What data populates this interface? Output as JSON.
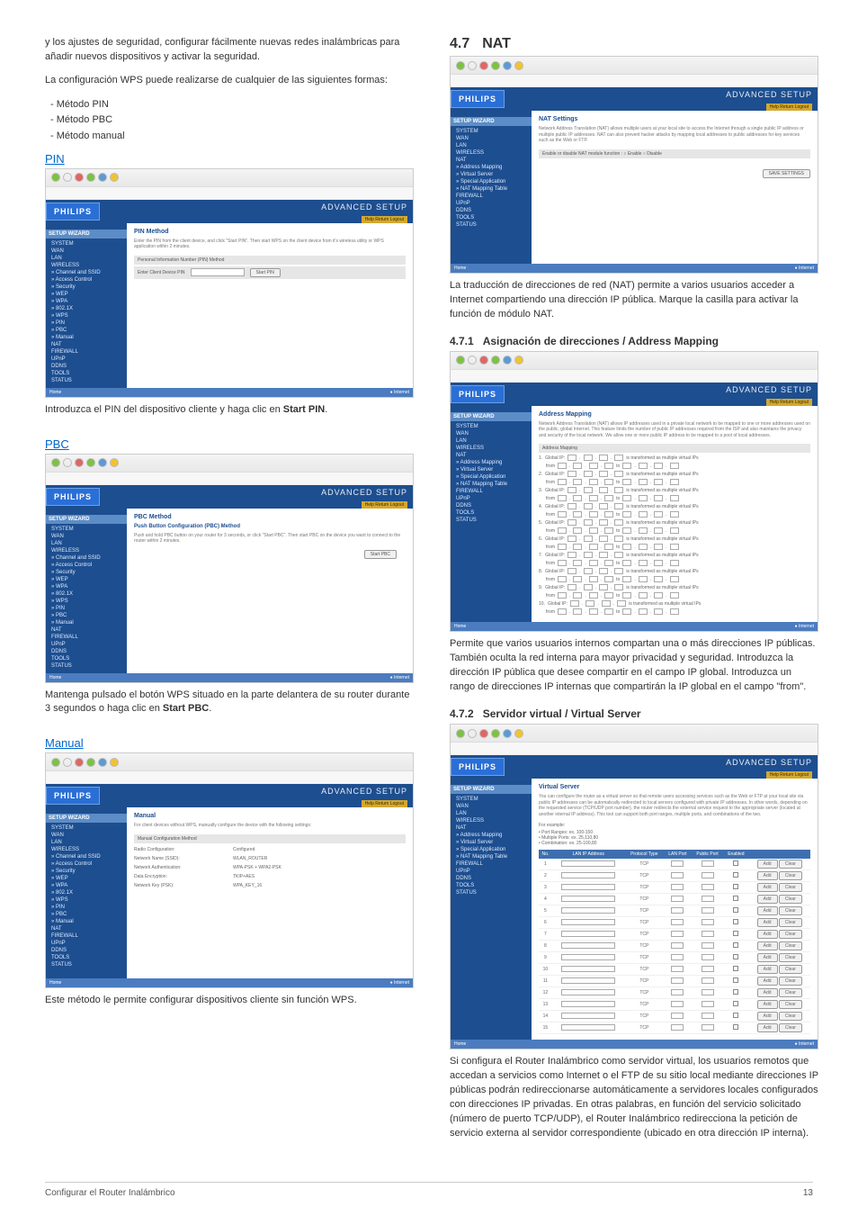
{
  "left": {
    "intro1": "y los ajustes de seguridad, configurar fácilmente nuevas redes inalámbricas para añadir nuevos dispositivos y activar la seguridad.",
    "intro2": "La configuración WPS puede realizarse de cualquier de las siguientes formas:",
    "bullets": [
      "- Método PIN",
      "- Método PBC",
      "- Método manual"
    ],
    "pin_heading": "PIN",
    "pbc_heading": "PBC",
    "manual_heading": "Manual",
    "pin_caption_a": "Introduzca el PIN del dispositivo cliente y haga clic en ",
    "pin_caption_b": "Start PIN",
    "pin_caption_c": ".",
    "pbc_caption_a": "Mantenga pulsado el botón WPS situado en la parte delantera de su router durante 3 segundos o haga clic en ",
    "pbc_caption_b": "Start PBC",
    "pbc_caption_c": ".",
    "manual_caption": "Este método le permite configurar dispositivos cliente sin función WPS."
  },
  "right": {
    "sec47_num": "4.7",
    "sec47_title": "NAT",
    "nat_caption": "La traducción de direcciones de red (NAT) permite a varios usuarios acceder a Internet compartiendo una dirección IP pública. Marque la casilla para activar la función de módulo NAT.",
    "sec471_num": "4.7.1",
    "sec471_title": "Asignación de direcciones / Address Mapping",
    "addr_caption": "Permite que varios usuarios internos compartan una o más direcciones IP públicas. También oculta la red interna para mayor privacidad y seguridad. Introduzca la dirección IP pública que desee compartir en el campo IP global. Introduzca un rango de direcciones IP internas que compartirán la IP global en el campo \"from\".",
    "sec472_num": "4.7.2",
    "sec472_title": "Servidor virtual / Virtual Server",
    "vs_caption": "Si configura el Router Inalámbrico como servidor virtual, los usuarios remotos que accedan a servicios como Internet o el FTP de su sitio local mediante direcciones IP públicas podrán redireccionarse automáticamente a servidores locales configurados con direcciones IP privadas. En otras palabras, en función del servicio solicitado (número de puerto TCP/UDP), el Router Inalámbrico redirecciona la petición de servicio externa al servidor correspondiente (ubicado en otra dirección IP interna)."
  },
  "shot": {
    "brand": "PHILIPS",
    "adv": "ADVANCED SETUP",
    "yellow": "Help  Return  Logout",
    "footer_left": "Home",
    "footer_right": "● Internet",
    "sidebar_hdr": "SETUP WIZARD",
    "sidebar_items_wireless": [
      "SYSTEM",
      "WAN",
      "LAN",
      "WIRELESS",
      "» Channel and SSID",
      "» Access Control",
      "» Security",
      "» WEP",
      "» WPA",
      "» 802.1X",
      "» WPS",
      "» PIN",
      "» PBC",
      "» Manual",
      "NAT",
      "FIREWALL",
      "UPnP",
      "DDNS",
      "TOOLS",
      "STATUS"
    ],
    "sidebar_items_nat": [
      "SYSTEM",
      "WAN",
      "LAN",
      "WIRELESS",
      "NAT",
      "» Address Mapping",
      "» Virtual Server",
      "» Special Application",
      "» NAT Mapping Table",
      "FIREWALL",
      "UPnP",
      "DDNS",
      "TOOLS",
      "STATUS"
    ],
    "pin": {
      "title": "PIN Method",
      "desc": "Enter the PIN from the client device, and click \"Start PIN\". Then start WPS on the client device from it's wireless utility or WPS application within 2 minutes.",
      "band_label": "Personal Information Number (PIN) Method",
      "input_label": "Enter Client Device PIN",
      "btn": "Start PIN"
    },
    "pbc": {
      "title": "PBC Method",
      "subtitle": "Push Button Configuration (PBC) Method",
      "desc": "Push and hold PBC button on your router for 3 seconds, or click \"Start PBC\". Then start PBC on the device you want to connect to the router within 2 minutes.",
      "btn": "Start PBC"
    },
    "manual": {
      "title": "Manual",
      "desc": "For client devices without WPS, manually configure the device with the following settings:",
      "band": "Manual Configuration Method",
      "rows": [
        [
          "Radio Configuration:",
          "Configured"
        ],
        [
          "Network Name (SSID):",
          "WLAN_ROUTER"
        ],
        [
          "Network Authentication:",
          "WPA-PSK + WPA2-PSK"
        ],
        [
          "Data Encryption:",
          "TKIP+AES"
        ],
        [
          "Network Key (PSK):",
          "WPA_KEY_16"
        ]
      ]
    },
    "nat": {
      "title": "NAT Settings",
      "desc": "Network Address Translation (NAT) allows multiple users at your local site to access the Internet through a single public IP address or multiple public IP addresses. NAT can also prevent hacker attacks by mapping local addresses to public addresses for key services such as the Web or FTP.",
      "band": "Enable or disable NAT module function :  ○ Enable  ○ Disable",
      "btn": "SAVE SETTINGS"
    },
    "addr": {
      "title": "Address Mapping",
      "desc": "Network Address Translation (NAT) allows IP addresses used in a private local network to be mapped to one or more addresses used on the public, global Internet. This feature limits the number of public IP addresses required from the ISP and also maintains the privacy and security of the local network. We allow one or more public IP address to be mapped to a pool of local addresses.",
      "section": "Address Mapping",
      "row_global": "Global IP:",
      "row_text": "is transformed as multiple virtual IPs",
      "row_from": "from"
    },
    "vs": {
      "title": "Virtual Server",
      "desc": "You can configure the router as a virtual server so that remote users accessing services such as the Web or FTP at your local site via public IP addresses can be automatically redirected to local servers configured with private IP addresses. In other words, depending on the requested service (TCP/UDP port number), the router redirects the external service request to the appropriate server (located at another internal IP address). This tool can support both port ranges, multiple ports, and combinations of the two.",
      "example_label": "For example:",
      "examples": [
        "• Port Ranges: ex. 100-150",
        "• Multiple Ports: ex. 25,110,80",
        "• Combination: ex. 25-100,80"
      ],
      "headers": [
        "No.",
        "LAN IP Address",
        "Protocol Type",
        "LAN Port",
        "Public Port",
        "Enabled"
      ],
      "proto": "TCP",
      "row_btns": [
        "Add",
        "Clear"
      ]
    }
  },
  "footer": {
    "left": "Configurar el Router Inalámbrico",
    "right": "13"
  }
}
